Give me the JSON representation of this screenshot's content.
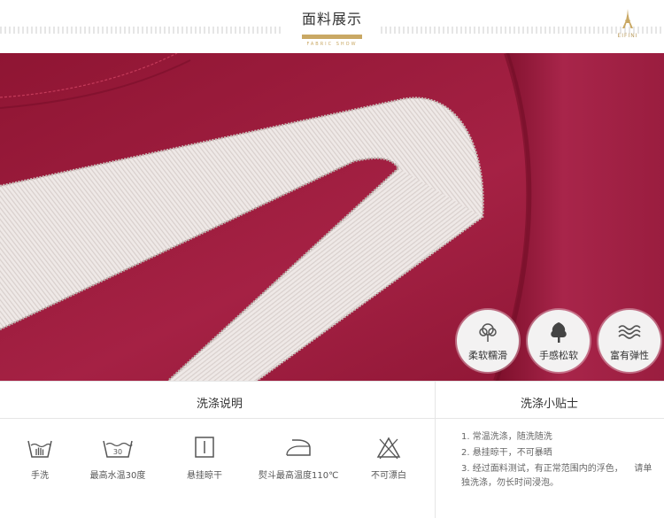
{
  "header": {
    "title": "面料展示",
    "subtitle": "FABRIC SHOW",
    "brand": "EIFINI"
  },
  "features": [
    {
      "label": "柔软糯滑",
      "icon": "cotton-flower-icon"
    },
    {
      "label": "手感松软",
      "icon": "tree-icon"
    },
    {
      "label": "富有弹性",
      "icon": "waves-icon"
    }
  ],
  "washing": {
    "title": "洗涤说明",
    "items": [
      {
        "label": "手洗",
        "icon": "hand-wash-icon"
      },
      {
        "label": "最高水温30度",
        "icon": "wash-30-icon",
        "temp": "30"
      },
      {
        "label": "悬挂晾干",
        "icon": "line-dry-icon"
      },
      {
        "label": "熨斗最高温度110℃",
        "icon": "iron-icon"
      },
      {
        "label": "不可漂白",
        "icon": "no-bleach-icon"
      }
    ]
  },
  "tips": {
    "title": "洗涤小贴士",
    "items": [
      "1. 常温洗涤，随洗随洗",
      "2. 悬挂晾干，不可暴晒",
      "3. 经过面料测试，有正常范围内的浮色，    请单独洗涤，勿长时间浸泡。"
    ]
  },
  "colors": {
    "fabric": "#9c1c3c",
    "ribbon": "#ece6e4",
    "gold": "#c9a864"
  }
}
